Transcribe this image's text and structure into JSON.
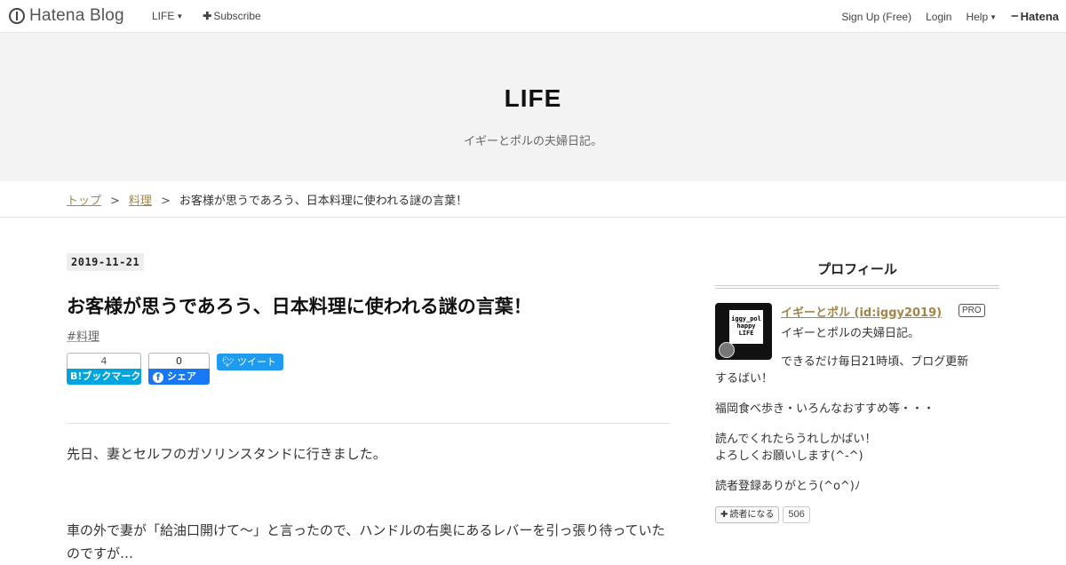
{
  "topbar": {
    "brand": "Hatena Blog",
    "nav_left": [
      {
        "label": "LIFE",
        "has_caret": true
      },
      {
        "label": "Subscribe",
        "icon": "plus-icon"
      }
    ],
    "nav_right": [
      {
        "label": "Sign Up (Free)"
      },
      {
        "label": "Login"
      },
      {
        "label": "Help",
        "has_caret": true
      }
    ],
    "hatena_label": "Hatena"
  },
  "header": {
    "title": "LIFE",
    "description": "イギーとポルの夫婦日記。",
    "background": "#f3f3f3"
  },
  "breadcrumb": {
    "items": [
      "トップ",
      "料理"
    ],
    "separator": ">",
    "current": "お客様が思うであろう、日本料理に使われる謎の言葉！",
    "link_color": "#a2854a"
  },
  "entry": {
    "date": "2019-11-21",
    "title": "お客様が思うであろう、日本料理に使われる謎の言葉！",
    "tag": "#料理",
    "share": {
      "hatebu_count": "4",
      "hatebu_label": "ブックマーク",
      "hatebu_mark": "B!",
      "facebook_count": "0",
      "facebook_label": "シェア",
      "tweet_label": "ツイート"
    },
    "paragraphs": [
      "先日、妻とセルフのガソリンスタンドに行きました。",
      "車の外で妻が「給油口開けて～」と言ったので、ハンドルの右奥にあるレバーを引っ張り待っていたのですが…"
    ]
  },
  "sidebar": {
    "title": "プロフィール",
    "profile_name": "イギーとポル (id:iggy2019)",
    "badge": "PRO",
    "avatar_text": [
      "iggy_pol",
      "happy",
      "LIFE"
    ],
    "lines": [
      "イギーとポルの夫婦日記。",
      "できるだけ毎日21時頃、ブログ更新",
      "するばい！",
      "福岡食べ歩き・いろんなおすすめ等・・・",
      "読んでくれたらうれしかばい！",
      "よろしくお願いします(^-^)",
      "読者登録ありがとう(^o^)ﾉ"
    ],
    "follow_label": "読者になる",
    "follow_count": "506"
  }
}
